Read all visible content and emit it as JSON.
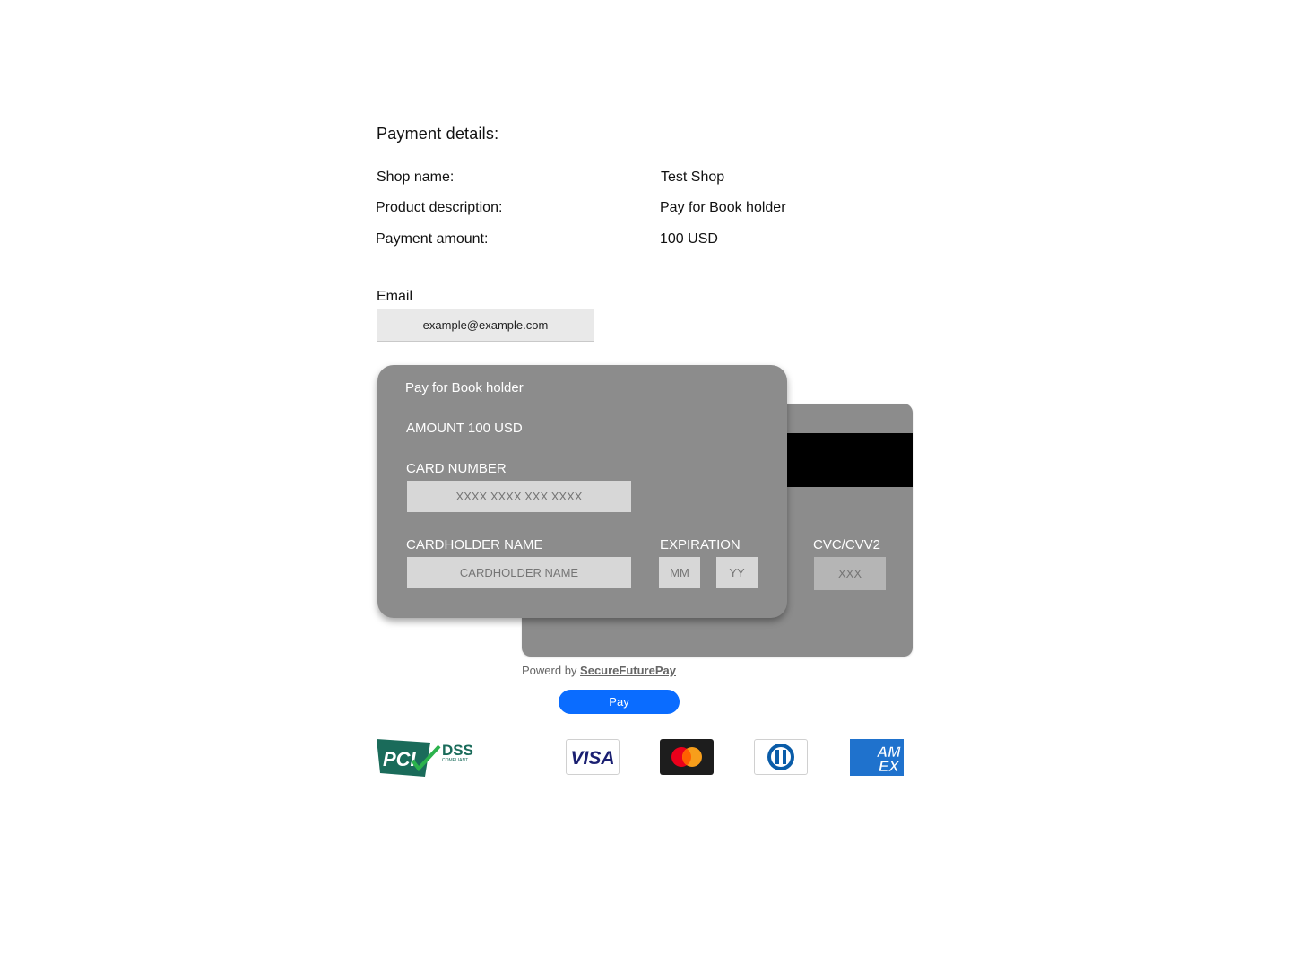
{
  "details": {
    "heading": "Payment details:",
    "shop_label": "Shop name:",
    "shop_value": "Test Shop",
    "description_label": "Product description:",
    "description_value": "Pay for Book holder",
    "amount_label": "Payment amount:",
    "amount_value": "100 USD"
  },
  "email": {
    "label": "Email",
    "value": "example@example.com"
  },
  "card_front": {
    "description": "Pay for Book holder",
    "amount": "AMOUNT 100 USD",
    "card_number_label": "CARD NUMBER",
    "card_number_placeholder": "XXXX XXXX XXX XXXX",
    "cardholder_label": "CARDHOLDER NAME",
    "cardholder_placeholder": "CARDHOLDER NAME",
    "expiration_label": "EXPIRATION",
    "month_placeholder": "MM",
    "year_placeholder": "YY"
  },
  "card_back": {
    "cvc_label": "CVC/CVV2",
    "cvc_placeholder": "XXX"
  },
  "footer": {
    "powered_prefix": "Powerd by",
    "powered_link": "SecureFuturePay",
    "pay_button": "Pay"
  },
  "logos": {
    "pci_main": "PCI",
    "pci_dss": "DSS",
    "pci_compliant": "COMPLIANT",
    "visa": "VISA",
    "amex_line1": "AM",
    "amex_line2": "EX"
  },
  "colors": {
    "card": "#8c8c8c",
    "pay_button": "#0a6cff",
    "amex": "#1f72cd",
    "pci_green": "#1a6b5a"
  }
}
